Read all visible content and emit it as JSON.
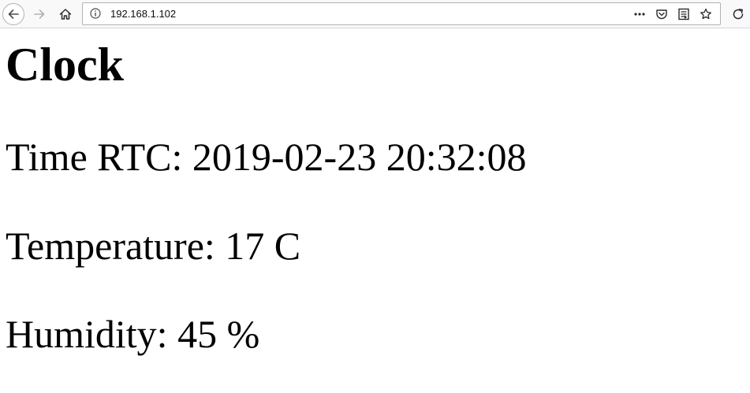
{
  "browser": {
    "url": "192.168.1.102",
    "icons": {
      "back": "arrow-left-icon",
      "forward": "arrow-right-icon",
      "home": "home-icon",
      "info": "info-icon",
      "more": "more-horizontal-icon",
      "pocket": "pocket-icon",
      "reader": "reader-view-icon",
      "bookmark": "star-icon",
      "reload": "reload-icon"
    }
  },
  "page": {
    "title": "Clock",
    "time_label": "Time RTC:",
    "time_value": "2019-02-23 20:32:08",
    "temperature_label": "Temperature:",
    "temperature_value": "17 C",
    "humidity_label": "Humidity:",
    "humidity_value": "45 %"
  }
}
